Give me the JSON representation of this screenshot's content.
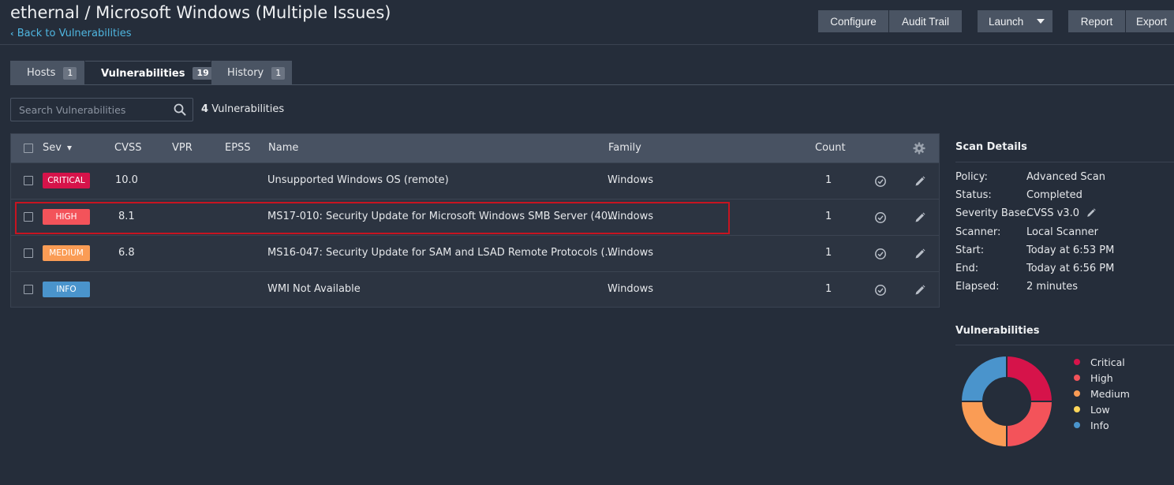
{
  "header": {
    "title": "ethernal / Microsoft Windows (Multiple Issues)",
    "back_link": "Back to Vulnerabilities",
    "buttons": {
      "configure": "Configure",
      "audit_trail": "Audit Trail",
      "launch": "Launch",
      "report": "Report",
      "export": "Export"
    }
  },
  "tabs": [
    {
      "label": "Hosts",
      "count": "1"
    },
    {
      "label": "Vulnerabilities",
      "count": "19"
    },
    {
      "label": "History",
      "count": "1"
    }
  ],
  "search": {
    "placeholder": "Search Vulnerabilities",
    "result_count": "4",
    "result_label": "Vulnerabilities"
  },
  "table": {
    "headers": {
      "sev": "Sev",
      "cvss": "CVSS",
      "vpr": "VPR",
      "epss": "EPSS",
      "name": "Name",
      "family": "Family",
      "count": "Count"
    },
    "rows": [
      {
        "severity": "CRITICAL",
        "color": "#d6134a",
        "cvss": "10.0",
        "name": "Unsupported Windows OS (remote)",
        "family": "Windows",
        "count": "1"
      },
      {
        "severity": "HIGH",
        "color": "#f3535a",
        "cvss": "8.1",
        "name": "MS17-010: Security Update for Microsoft Windows SMB Server (40...",
        "family": "Windows",
        "count": "1"
      },
      {
        "severity": "MEDIUM",
        "color": "#fa9c55",
        "cvss": "6.8",
        "name": "MS16-047: Security Update for SAM and LSAD Remote Protocols (...",
        "family": "Windows",
        "count": "1"
      },
      {
        "severity": "INFO",
        "color": "#4a94cc",
        "cvss": "",
        "name": "WMI Not Available",
        "family": "Windows",
        "count": "1"
      }
    ]
  },
  "scan_details": {
    "title": "Scan Details",
    "items": [
      {
        "label": "Policy:",
        "value": "Advanced Scan"
      },
      {
        "label": "Status:",
        "value": "Completed"
      },
      {
        "label": "Severity Base:",
        "value": "CVSS v3.0"
      },
      {
        "label": "Scanner:",
        "value": "Local Scanner"
      },
      {
        "label": "Start:",
        "value": "Today at 6:53 PM"
      },
      {
        "label": "End:",
        "value": "Today at 6:56 PM"
      },
      {
        "label": "Elapsed:",
        "value": "2 minutes"
      }
    ]
  },
  "vulnerabilities_chart": {
    "title": "Vulnerabilities",
    "legend": [
      {
        "label": "Critical",
        "color": "#d6134a"
      },
      {
        "label": "High",
        "color": "#f3535a"
      },
      {
        "label": "Medium",
        "color": "#fa9c55"
      },
      {
        "label": "Low",
        "color": "#fdd65a"
      },
      {
        "label": "Info",
        "color": "#4a94cc"
      }
    ],
    "slices": [
      {
        "label": "Critical",
        "value": 1,
        "color": "#d6134a"
      },
      {
        "label": "High",
        "value": 1,
        "color": "#f3535a"
      },
      {
        "label": "Medium",
        "value": 1,
        "color": "#fa9c55"
      },
      {
        "label": "Info",
        "value": 1,
        "color": "#4a94cc"
      }
    ]
  },
  "icons": {
    "search": "search-icon",
    "settings": "gear-icon",
    "row_check": "check-circle-icon",
    "row_edit": "pencil-icon",
    "severity_edit": "pencil-icon",
    "sort": "sort-down-icon",
    "dropdown": "caret-down-icon",
    "back": "chevron-left-icon"
  }
}
